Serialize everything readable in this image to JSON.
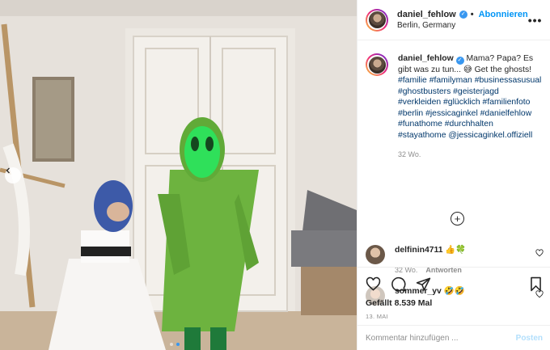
{
  "post": {
    "username": "daniel_fehlow",
    "follow_label": "Abonnieren",
    "location": "Berlin, Germany",
    "more_label": "•••"
  },
  "caption": {
    "username": "daniel_fehlow",
    "text": "Mama? Papa? Es gibt was zu tun... 😅 Get the ghosts!",
    "hashtags": "#familie #familyman #businessasusual #ghostbusters #geisterjagd #verkleiden #glücklich #familienfoto #berlin #jessicaginkel #danielfehlow #funathome #durchhalten #stayathome @jessicaginkel.offiziell",
    "time": "32 Wo."
  },
  "load_more": "+",
  "comments": [
    {
      "username": "delfinin4711",
      "text": "👍🍀",
      "time": "32 Wo.",
      "reply_label": "Antworten"
    },
    {
      "username": "sommer_yv",
      "text": "🤣🤣"
    }
  ],
  "likes": "Gefällt 8.539 Mal",
  "date": "13. MAI",
  "add_comment": {
    "placeholder": "Kommentar hinzufügen ...",
    "post_label": "Posten"
  },
  "icons": [
    "heart-icon",
    "comment-icon",
    "share-icon",
    "bookmark-icon",
    "chevron-left-icon",
    "plus-circle-icon"
  ],
  "colors": {
    "accent": "#0095f6",
    "hashtag": "#00376b",
    "muted": "#8e8e8e",
    "post_disabled": "#b2dffc"
  }
}
